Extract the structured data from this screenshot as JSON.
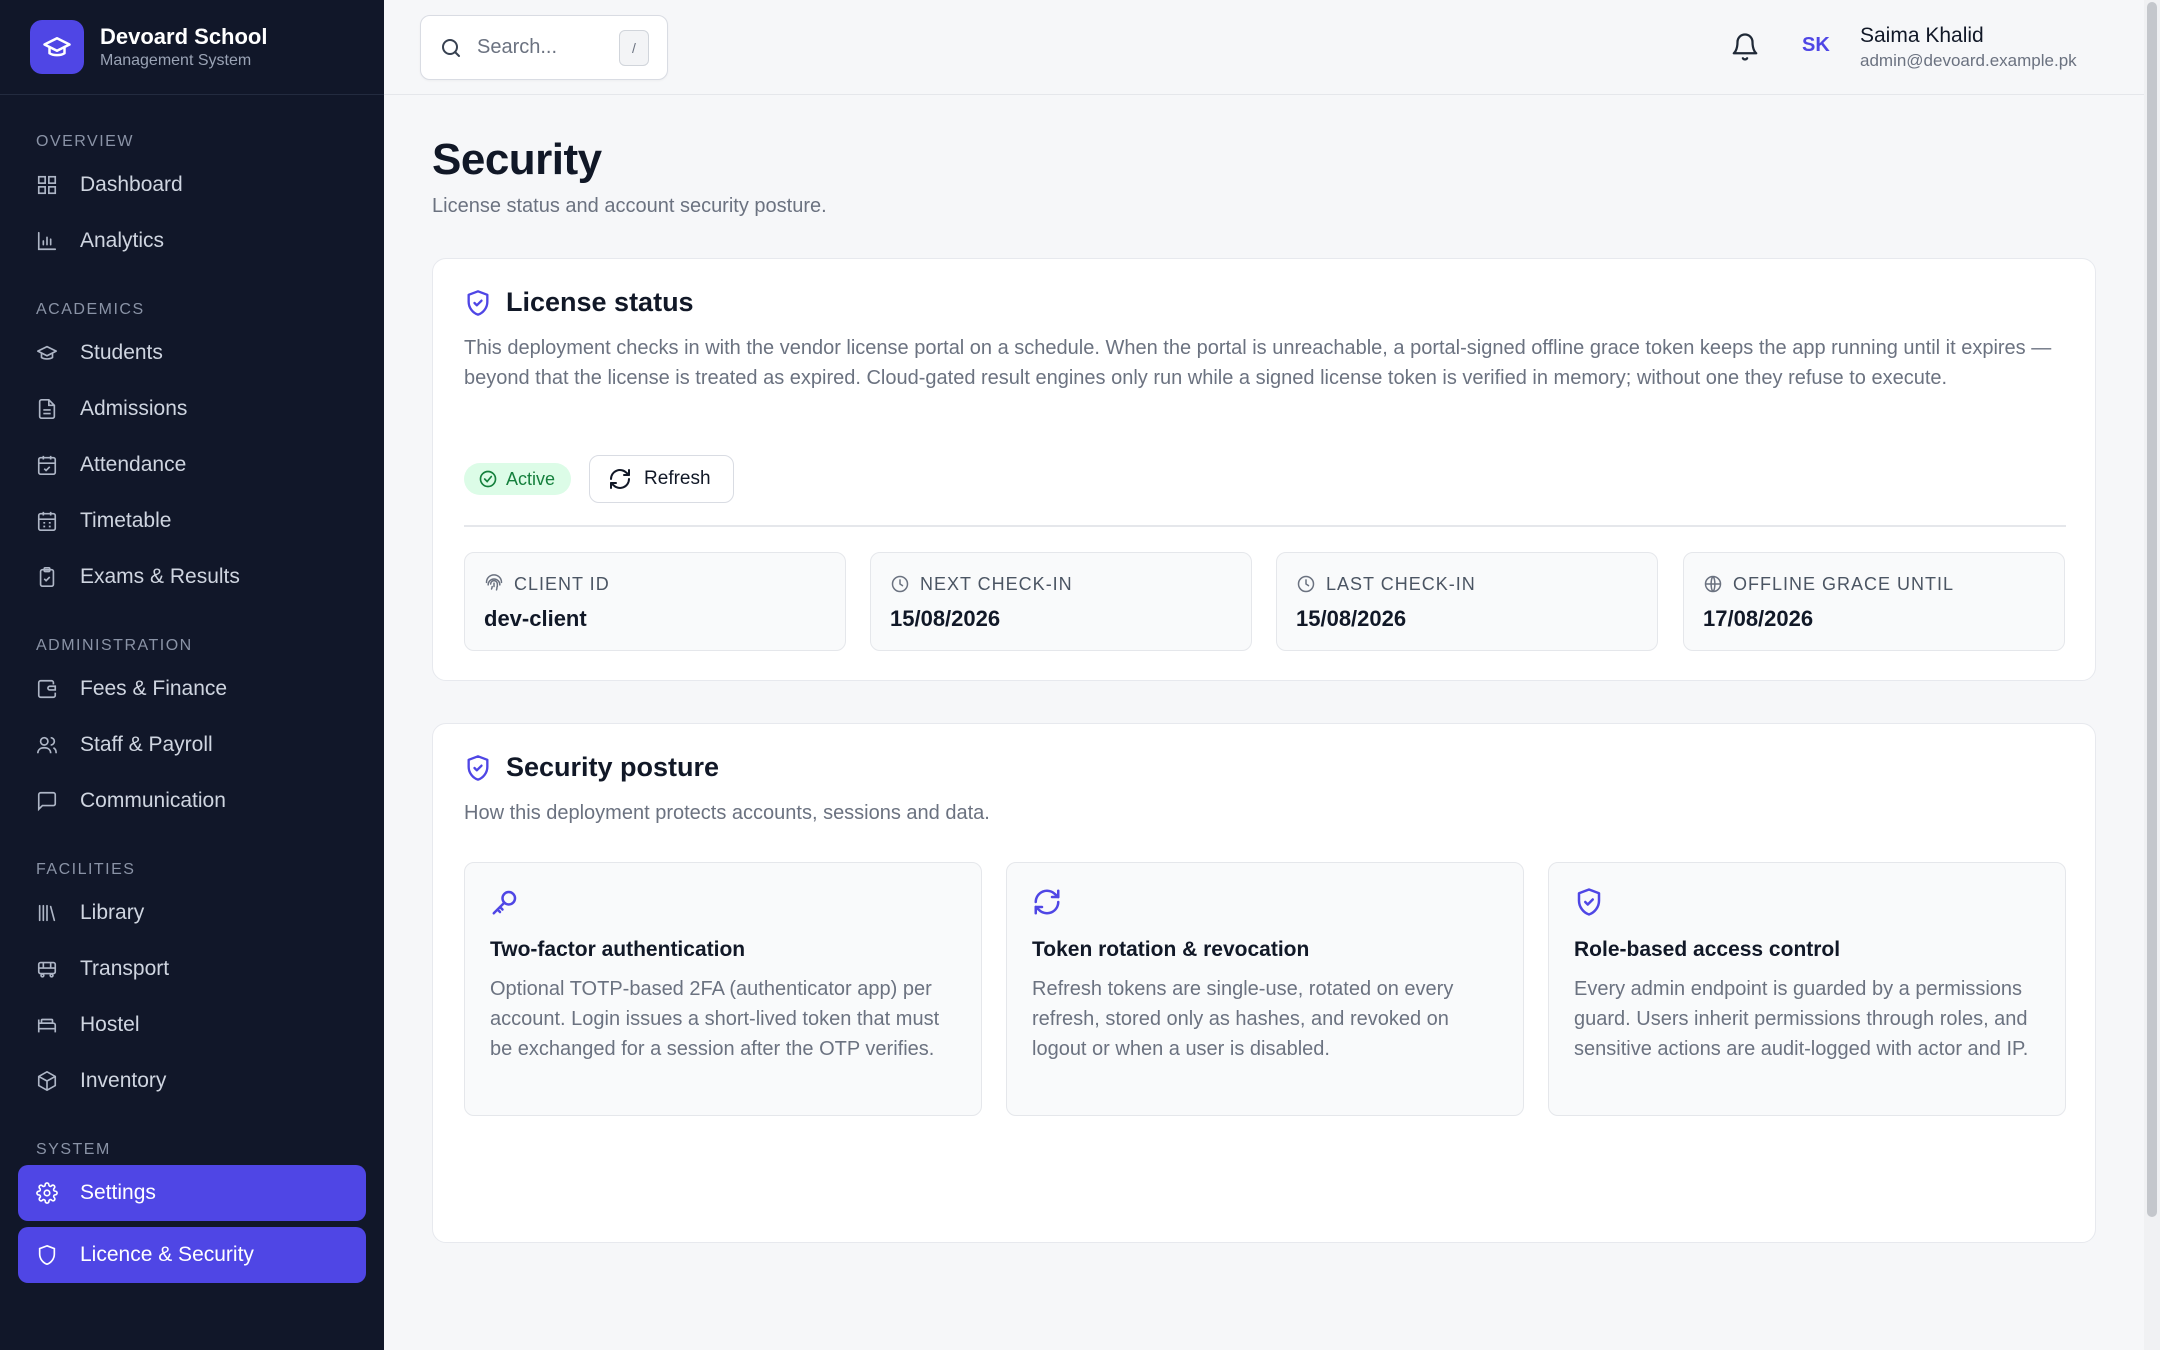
{
  "brand": {
    "name": "Devoard School",
    "subtitle": "Management System"
  },
  "sidebar": {
    "sections": [
      {
        "label": "OVERVIEW",
        "items": [
          {
            "label": "Dashboard",
            "icon": "dashboard-icon"
          },
          {
            "label": "Analytics",
            "icon": "chart-icon"
          }
        ]
      },
      {
        "label": "ACADEMICS",
        "items": [
          {
            "label": "Students",
            "icon": "graduation-cap-icon"
          },
          {
            "label": "Admissions",
            "icon": "document-icon"
          },
          {
            "label": "Attendance",
            "icon": "calendar-check-icon"
          },
          {
            "label": "Timetable",
            "icon": "calendar-icon"
          },
          {
            "label": "Exams & Results",
            "icon": "clipboard-icon"
          }
        ]
      },
      {
        "label": "ADMINISTRATION",
        "items": [
          {
            "label": "Fees & Finance",
            "icon": "wallet-icon"
          },
          {
            "label": "Staff & Payroll",
            "icon": "users-icon"
          },
          {
            "label": "Communication",
            "icon": "message-icon"
          }
        ]
      },
      {
        "label": "FACILITIES",
        "items": [
          {
            "label": "Library",
            "icon": "library-icon"
          },
          {
            "label": "Transport",
            "icon": "bus-icon"
          },
          {
            "label": "Hostel",
            "icon": "bed-icon"
          },
          {
            "label": "Inventory",
            "icon": "package-icon"
          }
        ]
      },
      {
        "label": "SYSTEM",
        "items": [
          {
            "label": "Settings",
            "icon": "gear-icon",
            "active": true
          },
          {
            "label": "Licence & Security",
            "icon": "shield-icon",
            "active": true
          }
        ]
      }
    ]
  },
  "topbar": {
    "search_placeholder": "Search...",
    "search_shortcut": "/",
    "user_initials": "SK",
    "user_name": "Saima Khalid",
    "user_email": "admin@devoard.example.pk"
  },
  "page": {
    "title": "Security",
    "subtitle": "License status and account security posture."
  },
  "license": {
    "title": "License status",
    "description": "This deployment checks in with the vendor license portal on a schedule. When the portal is unreachable, a portal-signed offline grace token keeps the app running until it expires — beyond that the license is treated as expired. Cloud-gated result engines only run while a signed license token is verified in memory; without one they refuse to execute.",
    "status": "Active",
    "status_color": "#15803d",
    "refresh_label": "Refresh",
    "stats": [
      {
        "label": "CLIENT ID",
        "value": "dev-client",
        "icon": "fingerprint-icon"
      },
      {
        "label": "NEXT CHECK-IN",
        "value": "15/08/2026",
        "icon": "clock-icon"
      },
      {
        "label": "LAST CHECK-IN",
        "value": "15/08/2026",
        "icon": "clock-icon"
      },
      {
        "label": "OFFLINE GRACE UNTIL",
        "value": "17/08/2026",
        "icon": "globe-icon"
      }
    ]
  },
  "posture": {
    "title": "Security posture",
    "subtitle": "How this deployment protects accounts, sessions and data.",
    "features": [
      {
        "title": "Two-factor authentication",
        "text": "Optional TOTP-based 2FA (authenticator app) per account. Login issues a short-lived token that must be exchanged for a session after the OTP verifies.",
        "icon": "key-icon"
      },
      {
        "title": "Token rotation & revocation",
        "text": "Refresh tokens are single-use, rotated on every refresh, stored only as hashes, and revoked on logout or when a user is disabled.",
        "icon": "refresh-icon"
      },
      {
        "title": "Role-based access control",
        "text": "Every admin endpoint is guarded by a permissions guard. Users inherit permissions through roles, and sensitive actions are audit-logged with actor and IP.",
        "icon": "shield-check-icon"
      }
    ]
  },
  "colors": {
    "accent": "#4f46e5",
    "sidebar_bg": "#111729",
    "success_bg": "#dcfce7"
  }
}
